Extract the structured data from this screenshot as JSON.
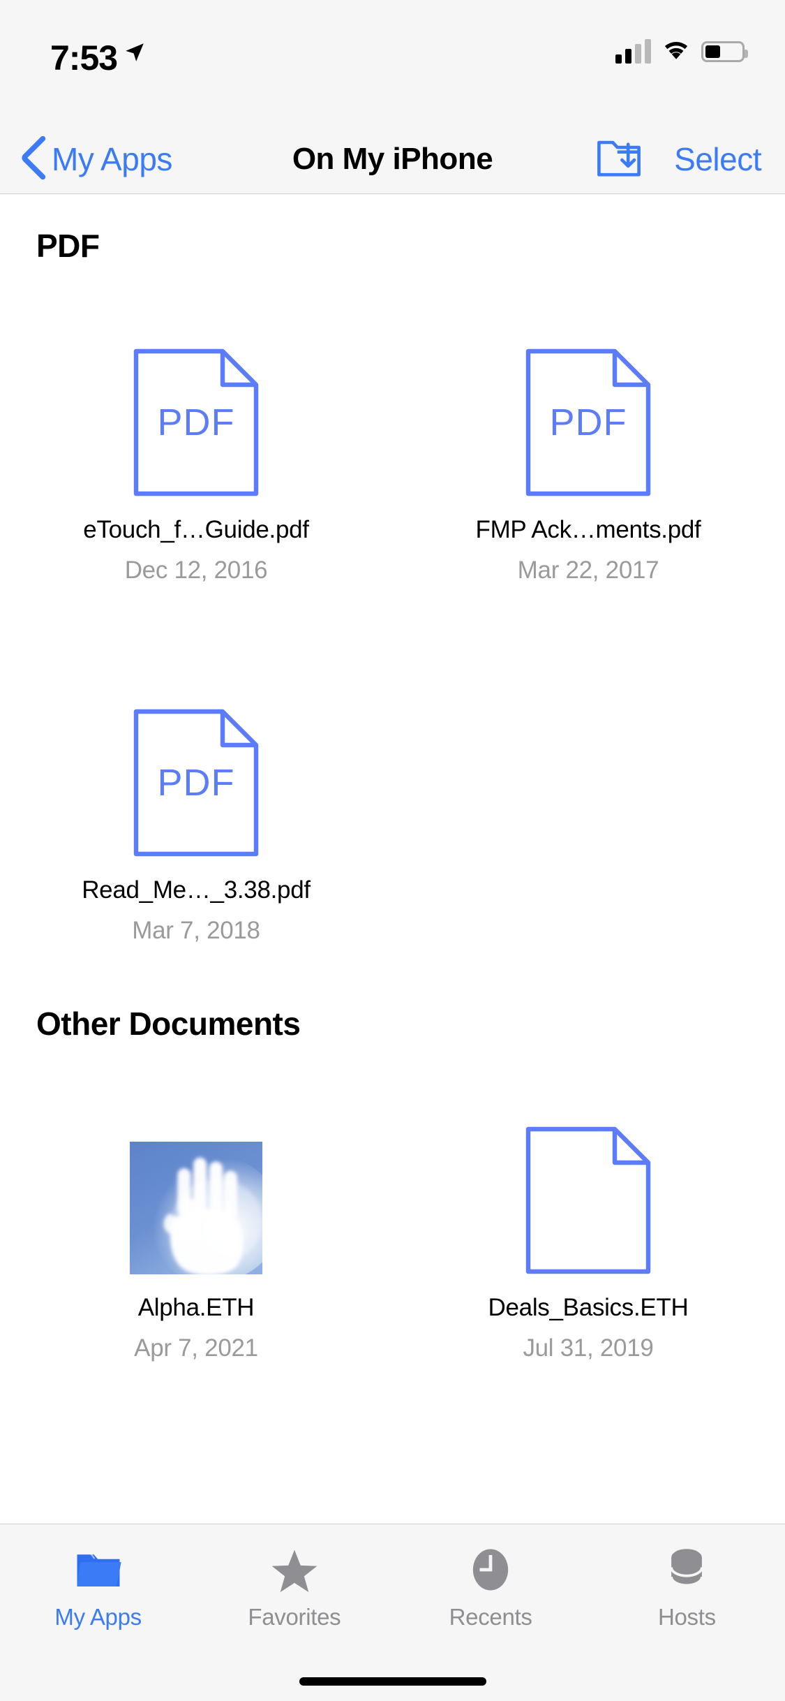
{
  "status_bar": {
    "time": "7:53",
    "location_icon": "location-arrow-icon",
    "cellular_icon": "cellular-signal-icon",
    "cellular_bars_filled": 2,
    "cellular_bars_total": 4,
    "wifi_icon": "wifi-icon",
    "battery_icon": "battery-icon",
    "battery_level_percent": 42
  },
  "nav_bar": {
    "back_label": "My Apps",
    "back_icon": "chevron-left-icon",
    "title": "On My iPhone",
    "import_icon": "folder-import-icon",
    "select_label": "Select"
  },
  "sections": [
    {
      "title": "PDF",
      "items": [
        {
          "name": "eTouch_f…Guide.pdf",
          "date": "Dec 12, 2016",
          "icon": "pdf-document-icon",
          "badge": "PDF"
        },
        {
          "name": "FMP Ack…ments.pdf",
          "date": "Mar 22, 2017",
          "icon": "pdf-document-icon",
          "badge": "PDF"
        },
        {
          "name": "Read_Me…_3.38.pdf",
          "date": "Mar 7, 2018",
          "icon": "pdf-document-icon",
          "badge": "PDF"
        }
      ]
    },
    {
      "title": "Other Documents",
      "items": [
        {
          "name": "Alpha.ETH",
          "date": "Apr 7, 2021",
          "icon": "image-thumbnail-hand",
          "badge": ""
        },
        {
          "name": "Deals_Basics.ETH",
          "date": "Jul 31, 2019",
          "icon": "blank-document-icon",
          "badge": ""
        }
      ]
    }
  ],
  "tab_bar": {
    "tabs": [
      {
        "label": "My Apps",
        "icon": "folder-icon",
        "active": true
      },
      {
        "label": "Favorites",
        "icon": "star-icon",
        "active": false
      },
      {
        "label": "Recents",
        "icon": "clock-icon",
        "active": false
      },
      {
        "label": "Hosts",
        "icon": "database-icon",
        "active": false
      }
    ]
  },
  "colors": {
    "accent_blue": "#3b7bf5",
    "icon_blue": "#5c7cfa",
    "inactive_gray": "#8e8e93",
    "date_gray": "#9a9a9a",
    "bar_background": "#f6f6f6"
  }
}
